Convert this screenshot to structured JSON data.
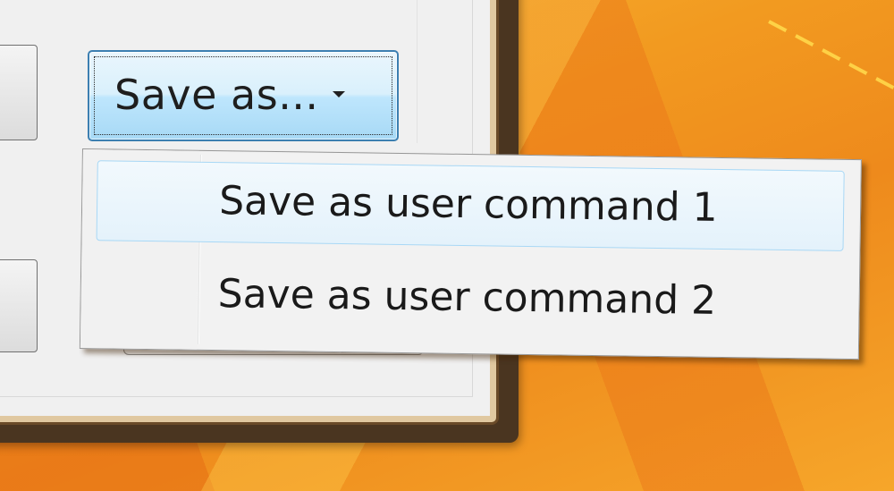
{
  "save_as_button": {
    "label": "Save as...",
    "icon": "chevron-down-icon"
  },
  "dropdown_menu": {
    "items": [
      {
        "label": "Save as user command 1",
        "state": "hover"
      },
      {
        "label": "Save as user command 2",
        "state": "normal"
      }
    ]
  },
  "colors": {
    "button_border": "#3c7fb1",
    "menu_hover_border": "#a8d8f6",
    "desktop": "#f29a20",
    "dialog_face": "#f0f0f0"
  }
}
